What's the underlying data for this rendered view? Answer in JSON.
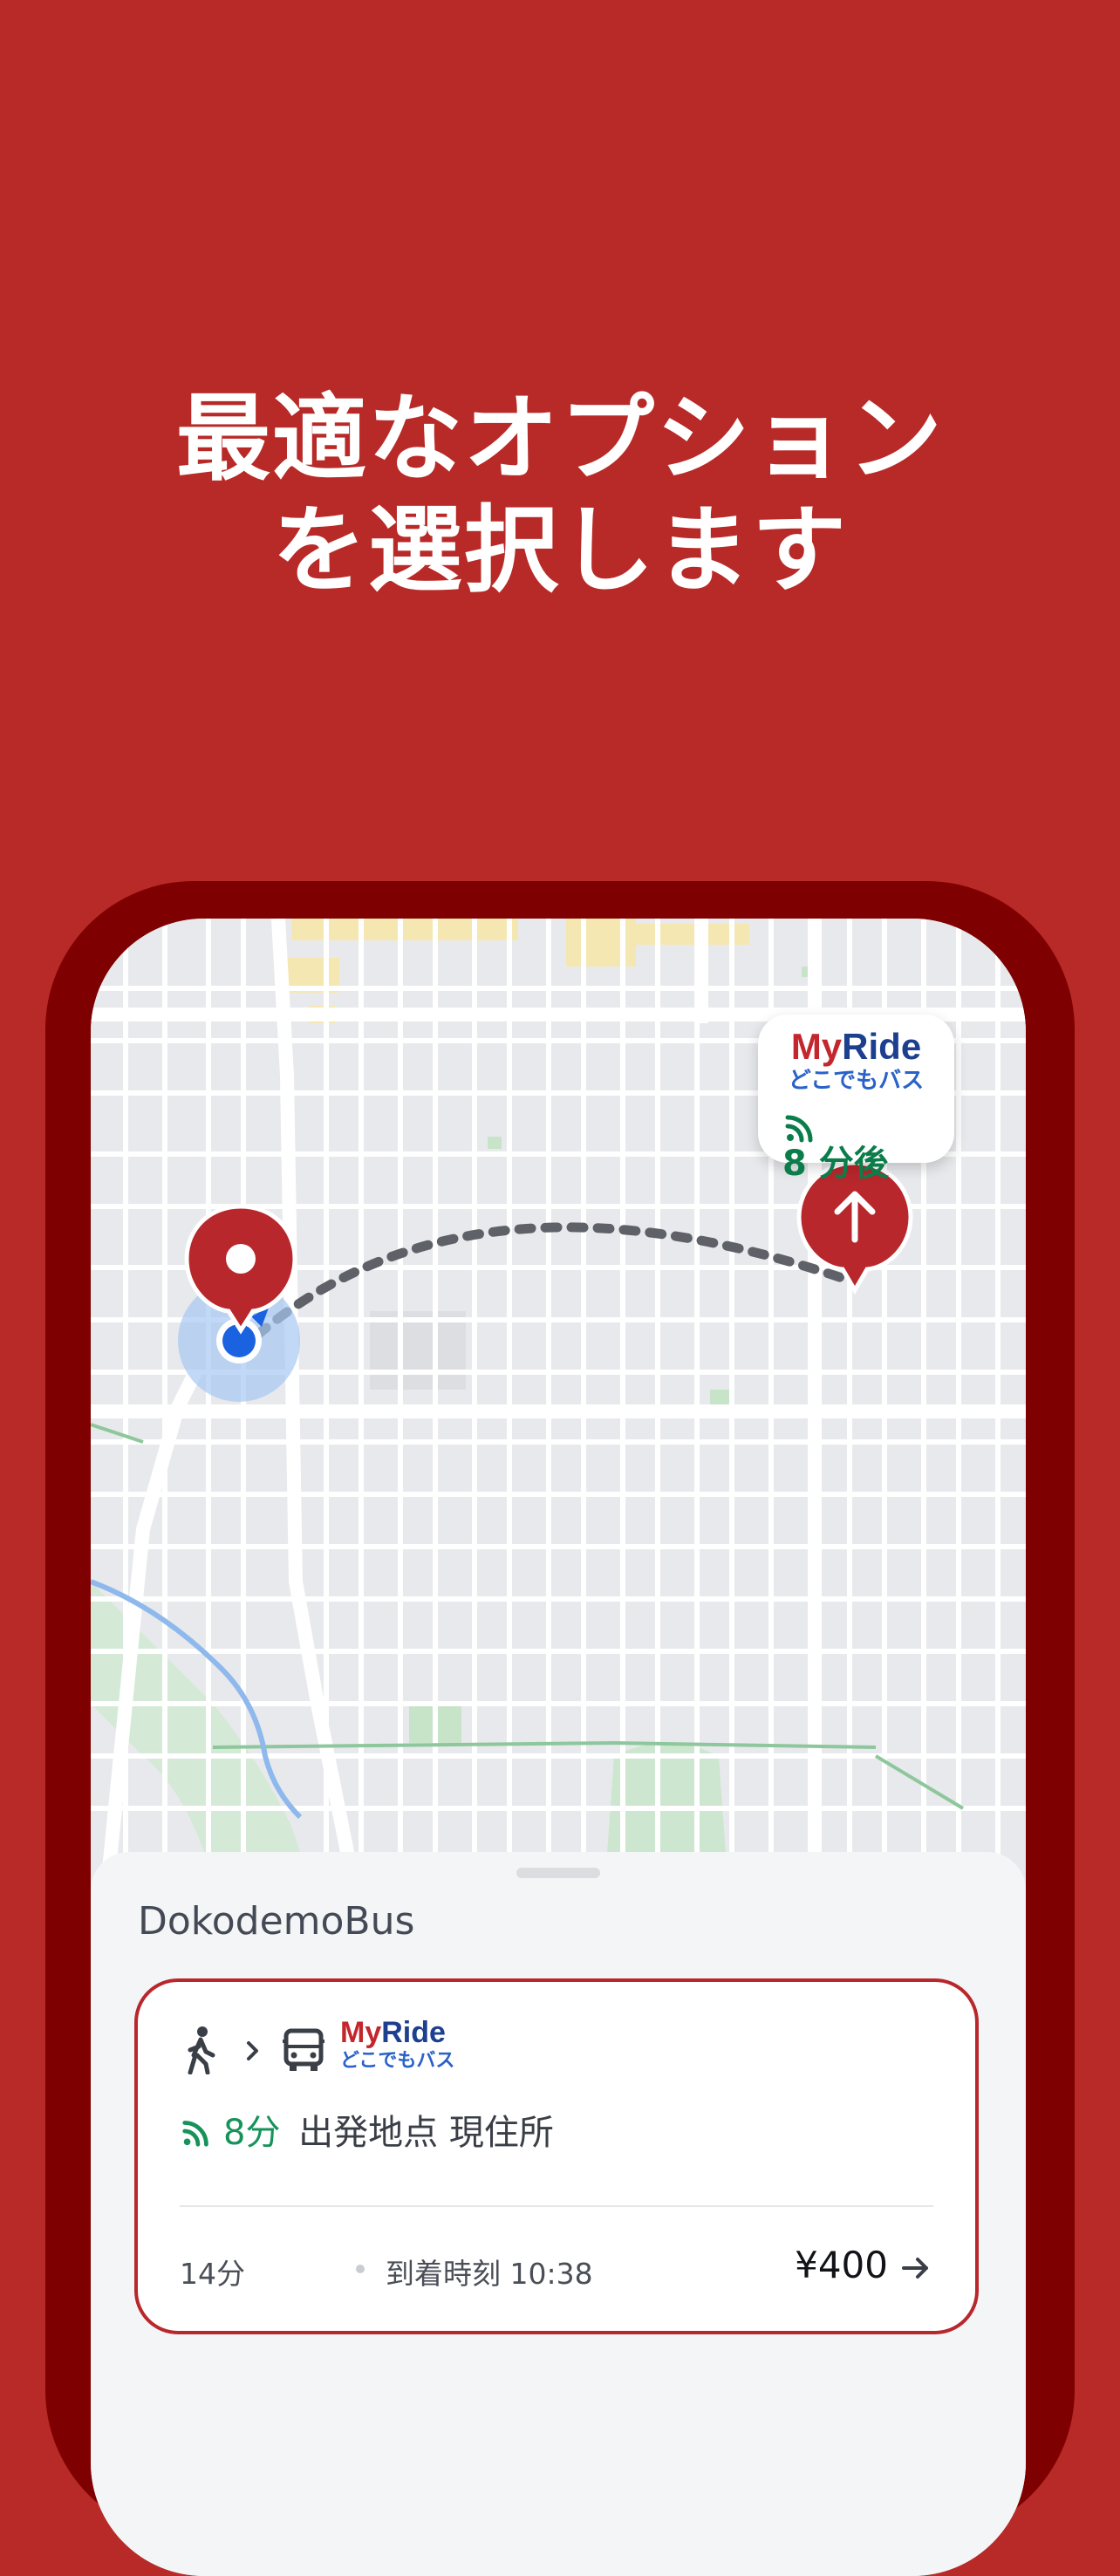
{
  "headline": {
    "line1": "最適なオプション",
    "line2": "を選択します"
  },
  "map_callout": {
    "logo_my": "My",
    "logo_ride": "Ride",
    "subtitle": "どこでもバス",
    "eta": "8 分後"
  },
  "sheet": {
    "title": "DokodemoBus"
  },
  "option_card": {
    "logo_my": "My",
    "logo_ride": "Ride",
    "logo_subtitle": "どこでもバス",
    "eta_time": "8分",
    "departure_text": "出発地点 現住所",
    "duration": "14分",
    "arrival_text": "到着時刻 10:38",
    "price": "¥400"
  },
  "colors": {
    "background": "#b82a27",
    "frame": "#7e0000",
    "accent": "#b8272c",
    "eta_green": "#15935a",
    "brand_blue": "#1d3f8f"
  },
  "icons": [
    "user-location-icon",
    "origin-pin-icon",
    "bus-arrow-icon",
    "live-signal-icon",
    "walk-icon",
    "chevron-right-icon",
    "bus-icon",
    "arrow-right-icon"
  ]
}
